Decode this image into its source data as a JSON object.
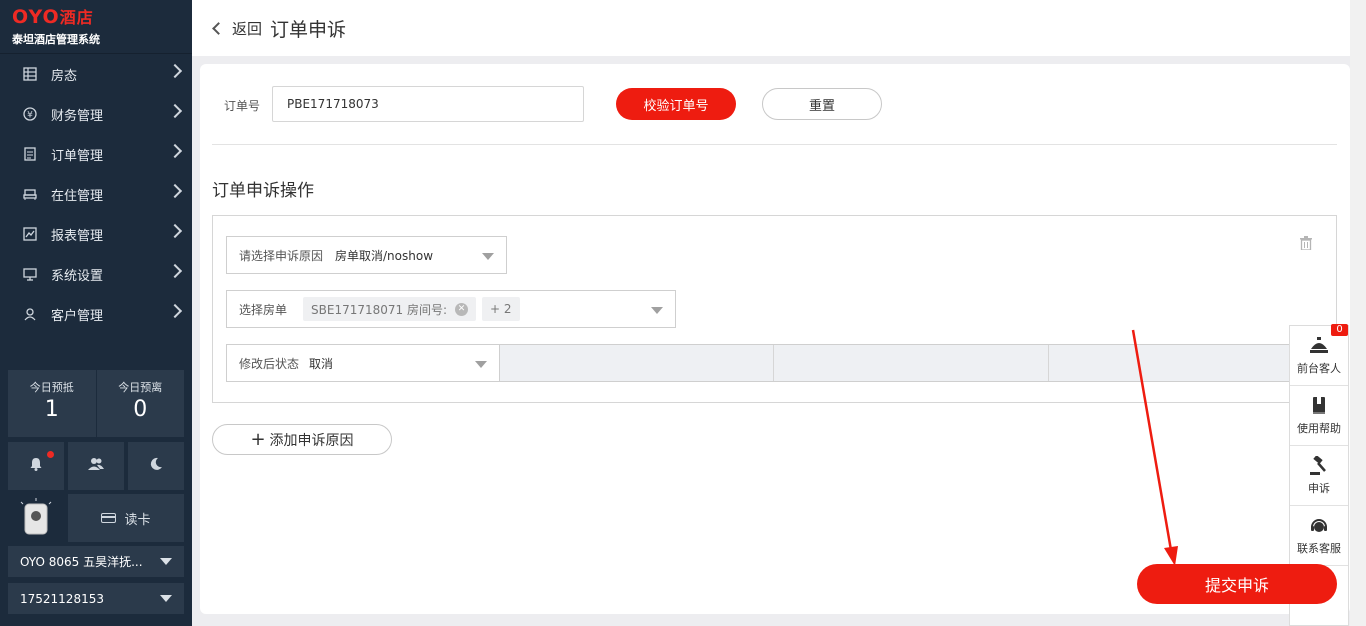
{
  "brand": {
    "logo_text": "OYO",
    "logo_suffix": "酒店",
    "system_name": "泰坦酒店管理系统"
  },
  "sidebar": {
    "items": [
      {
        "label": "房态",
        "icon": "grid-icon"
      },
      {
        "label": "财务管理",
        "icon": "yen-icon"
      },
      {
        "label": "订单管理",
        "icon": "document-icon"
      },
      {
        "label": "在住管理",
        "icon": "bed-icon"
      },
      {
        "label": "报表管理",
        "icon": "chart-icon"
      },
      {
        "label": "系统设置",
        "icon": "monitor-icon"
      },
      {
        "label": "客户管理",
        "icon": "person-icon"
      }
    ],
    "stats": [
      {
        "label": "今日预抵",
        "value": "1"
      },
      {
        "label": "今日预离",
        "value": "0"
      }
    ],
    "read_card_label": "读卡",
    "hotel_select": "OYO 8065 五昊洋抚...",
    "phone_select": "17521128153"
  },
  "header": {
    "back_label": "返回",
    "title": "订单申诉"
  },
  "form": {
    "order_label": "订单号",
    "order_value": "PBE171718073",
    "verify_button": "校验订单号",
    "reset_button": "重置",
    "section_title": "订单申诉操作",
    "reason_label": "请选择申诉原因",
    "reason_value": "房单取消/noshow",
    "room_label": "选择房单",
    "room_tag": "SBE171718071 房间号:",
    "room_more": "+ 2",
    "status_label": "修改后状态",
    "status_value": "取消",
    "add_reason_button": "添加申诉原因",
    "submit_button": "提交申诉"
  },
  "float_panel": {
    "badge": "0",
    "items": [
      {
        "label": "前台客人",
        "icon": "desk-bell-icon"
      },
      {
        "label": "使用帮助",
        "icon": "book-icon"
      },
      {
        "label": "申诉",
        "icon": "gavel-icon"
      },
      {
        "label": "联系客服",
        "icon": "headset-icon"
      }
    ]
  },
  "colors": {
    "accent": "#ee1c10",
    "sidebar_bg": "#1c2b3c",
    "sidebar_panel": "#2b3a4b",
    "annotation_arrow": "#ee1c10"
  }
}
